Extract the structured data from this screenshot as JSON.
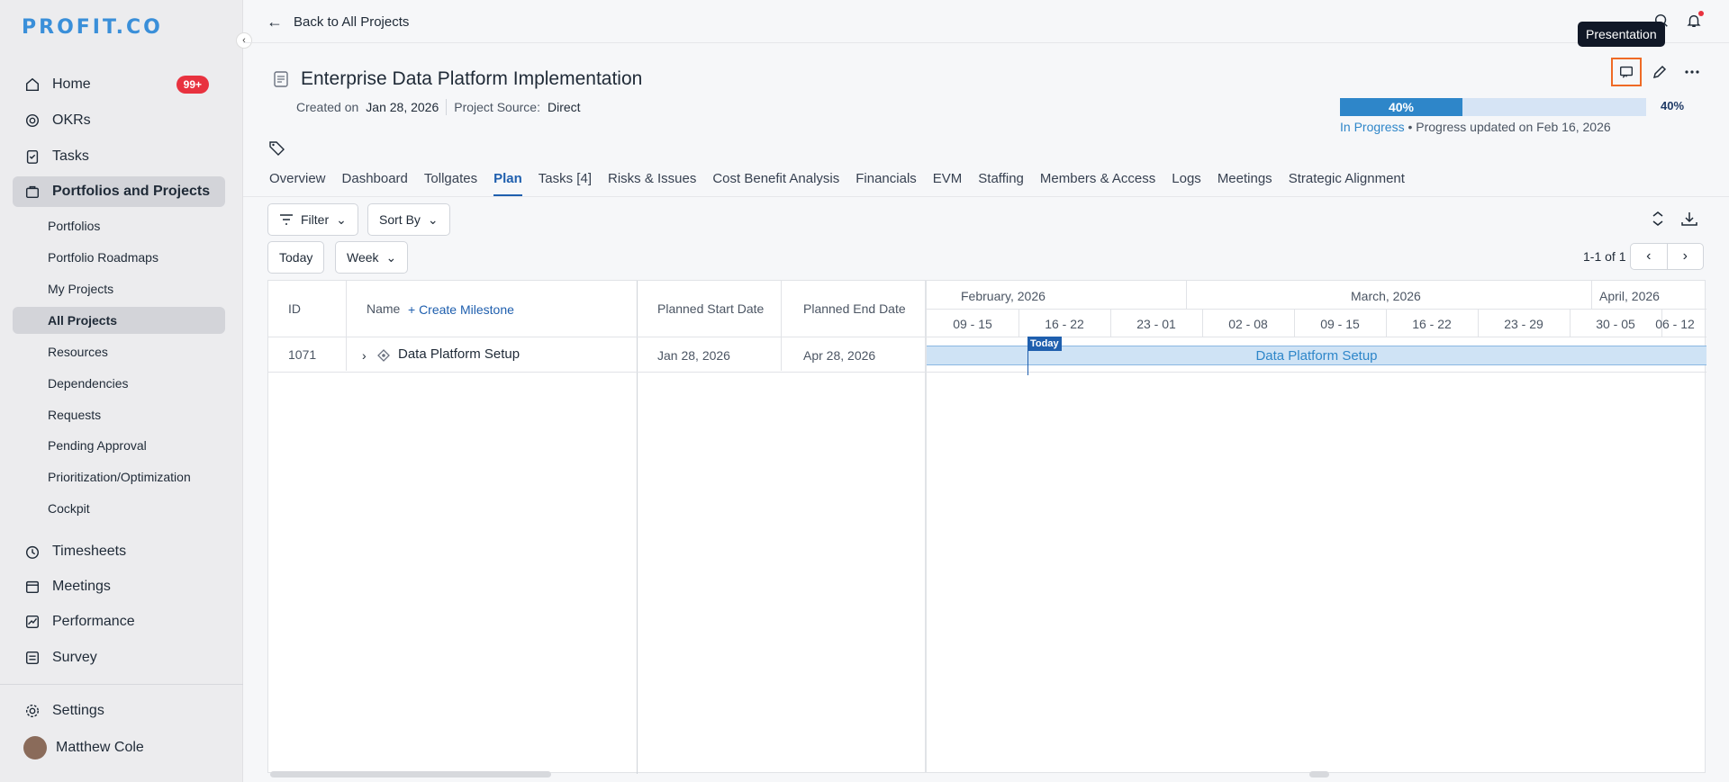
{
  "brand": {
    "logo": "PROFIT.CO"
  },
  "sidebar": {
    "items": [
      {
        "label": "Home",
        "icon": "home-icon",
        "badge": "99+"
      },
      {
        "label": "OKRs",
        "icon": "target-icon"
      },
      {
        "label": "Tasks",
        "icon": "clipboard-icon"
      },
      {
        "label": "Portfolios and Projects",
        "icon": "briefcase-icon"
      }
    ],
    "sub_items": [
      "Portfolios",
      "Portfolio Roadmaps",
      "My Projects",
      "All Projects",
      "Resources",
      "Dependencies",
      "Requests",
      "Pending Approval",
      "Prioritization/Optimization",
      "Cockpit"
    ],
    "lower_items": [
      {
        "label": "Timesheets",
        "icon": "clock-icon"
      },
      {
        "label": "Meetings",
        "icon": "calendar-icon"
      },
      {
        "label": "Performance",
        "icon": "chart-icon"
      },
      {
        "label": "Survey",
        "icon": "survey-icon"
      }
    ],
    "settings": "Settings",
    "user": "Matthew Cole"
  },
  "header": {
    "back": "Back to All Projects",
    "tooltip": "Presentation"
  },
  "project": {
    "title": "Enterprise Data Platform Implementation",
    "created_label": "Created on",
    "created_value": "Jan 28, 2026",
    "source_label": "Project Source:",
    "source_value": "Direct",
    "progress_label": "40%",
    "progress_value": 40,
    "progress_pct": "40%",
    "status": "In Progress",
    "status_suffix": " • Progress updated on Feb 16, 2026"
  },
  "tabs": [
    "Overview",
    "Dashboard",
    "Tollgates",
    "Plan",
    "Tasks [4]",
    "Risks & Issues",
    "Cost Benefit Analysis",
    "Financials",
    "EVM",
    "Staffing",
    "Members & Access",
    "Logs",
    "Meetings",
    "Strategic Alignment"
  ],
  "active_tab": "Plan",
  "toolbar": {
    "filter": "Filter",
    "sort": "Sort By",
    "today": "Today",
    "week": "Week",
    "pager": "1-1 of 1"
  },
  "table": {
    "headers": {
      "id": "ID",
      "name": "Name",
      "create": "+ Create Milestone",
      "start": "Planned Start Date",
      "end": "Planned End Date"
    },
    "rows": [
      {
        "id": "1071",
        "name": "Data Platform Setup",
        "start": "Jan 28, 2026",
        "end": "Apr 28, 2026"
      }
    ]
  },
  "gantt": {
    "months": [
      "February, 2026",
      "March, 2026",
      "April, 2026"
    ],
    "weeks": [
      "09 - 15",
      "16 - 22",
      "23 - 01",
      "02 - 08",
      "09 - 15",
      "16 - 22",
      "23 - 29",
      "30 - 05",
      "06 - 12"
    ],
    "today_label": "Today",
    "bar_label": "Data Platform Setup"
  }
}
